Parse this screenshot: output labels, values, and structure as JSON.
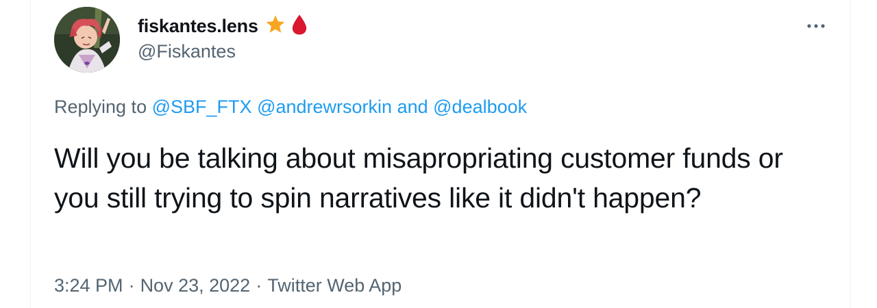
{
  "author": {
    "display_name": "fiskantes.lens",
    "handle": "@Fiskantes",
    "name_emojis": [
      "star-emoji",
      "blood-drop-emoji"
    ]
  },
  "reply_context": {
    "prefix": "Replying to",
    "mention_1": "@SBF_FTX",
    "mention_2": "@andrewrsorkin",
    "connector": "and",
    "mention_3": "@dealbook"
  },
  "tweet": {
    "text": "Will you be talking about misapropriating customer funds or you still trying to spin narratives like it didn't happen?"
  },
  "meta": {
    "time": "3:24 PM",
    "separator": "·",
    "date": "Nov 23, 2022",
    "source": "Twitter Web App"
  },
  "colors": {
    "link": "#1d9bf0",
    "secondary_text": "#536471",
    "primary_text": "#0f1419",
    "star": "#f6a623",
    "drop": "#d9172f"
  }
}
